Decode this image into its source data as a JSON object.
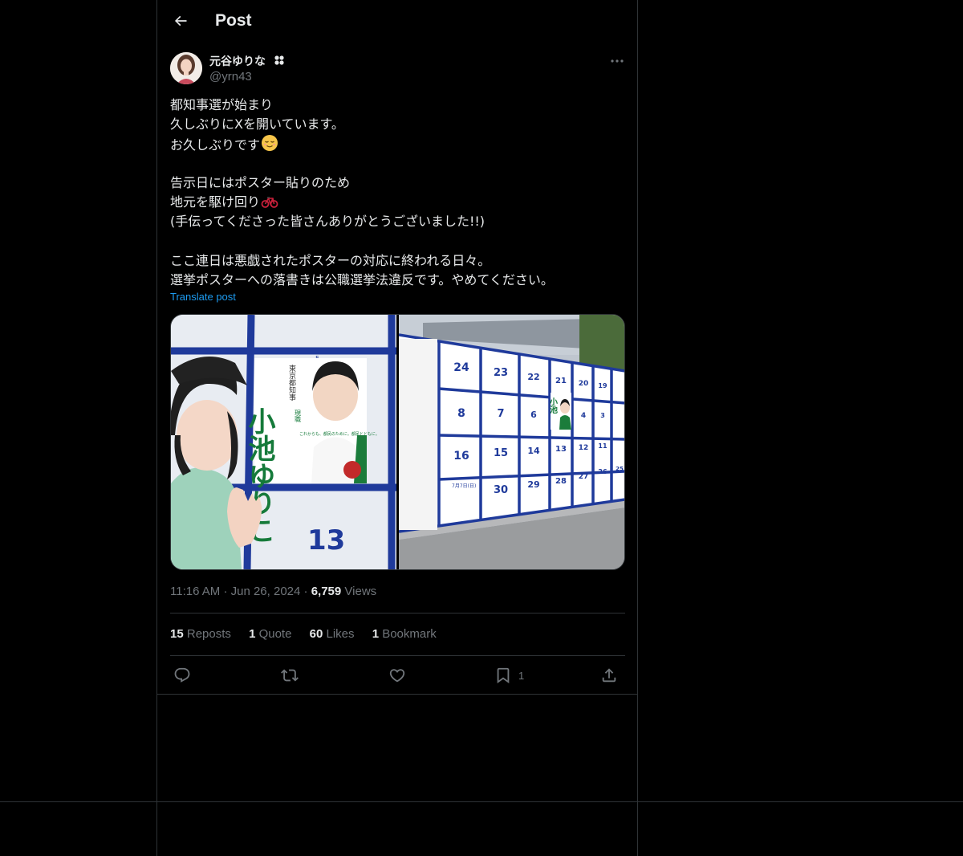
{
  "header": {
    "title": "Post"
  },
  "author": {
    "display_name": "元谷ゆりな",
    "handle": "@yrn43",
    "badge_icon": "clover-icon"
  },
  "post": {
    "lines": [
      "都知事選が始まり",
      "久しぶりにXを開いています。",
      "お久しぶりです",
      "",
      "告示日にはポスター貼りのため",
      "地元を駆け回り",
      "(手伝ってくださった皆さんありがとうございました!!)",
      "",
      "ここ連日は悪戯されたポスターの対応に終われる日々。",
      "選挙ポスターへの落書きは公職選挙法違反です。やめてください。"
    ],
    "translate_label": "Translate post"
  },
  "media": {
    "photo1": {
      "poster_name": "小池ゆりこ",
      "poster_office": "東京都知事",
      "poster_tag": "現職",
      "poster_slogan": "これからも、都民のために。都民とともに。",
      "board_numbers": [
        "5",
        "13",
        "13"
      ]
    },
    "photo2": {
      "board_numbers": [
        "24",
        "23",
        "22",
        "21",
        "20",
        "19",
        "8",
        "7",
        "6",
        "4",
        "3",
        "16",
        "15",
        "14",
        "13",
        "12",
        "11",
        "30",
        "29",
        "28",
        "27",
        "26",
        "25"
      ],
      "notice_date": "7月7日(日)"
    }
  },
  "meta": {
    "time": "11:16 AM",
    "date": "Jun 26, 2024",
    "views_count": "6,759",
    "views_label": "Views",
    "separator": "·"
  },
  "stats": {
    "reposts_count": "15",
    "reposts_label": "Reposts",
    "quotes_count": "1",
    "quotes_label": "Quote",
    "likes_count": "60",
    "likes_label": "Likes",
    "bookmarks_count": "1",
    "bookmarks_label": "Bookmark"
  },
  "actions": {
    "reply_icon": "reply-icon",
    "repost_icon": "repost-icon",
    "like_icon": "heart-icon",
    "bookmark_icon": "bookmark-icon",
    "bookmark_count": "1",
    "share_icon": "share-icon"
  },
  "colors": {
    "background": "#000000",
    "text": "#e7e9ea",
    "muted": "#71767b",
    "link": "#1d9bf0",
    "border": "#2f3336",
    "board_blue": "#1f3a9b"
  }
}
